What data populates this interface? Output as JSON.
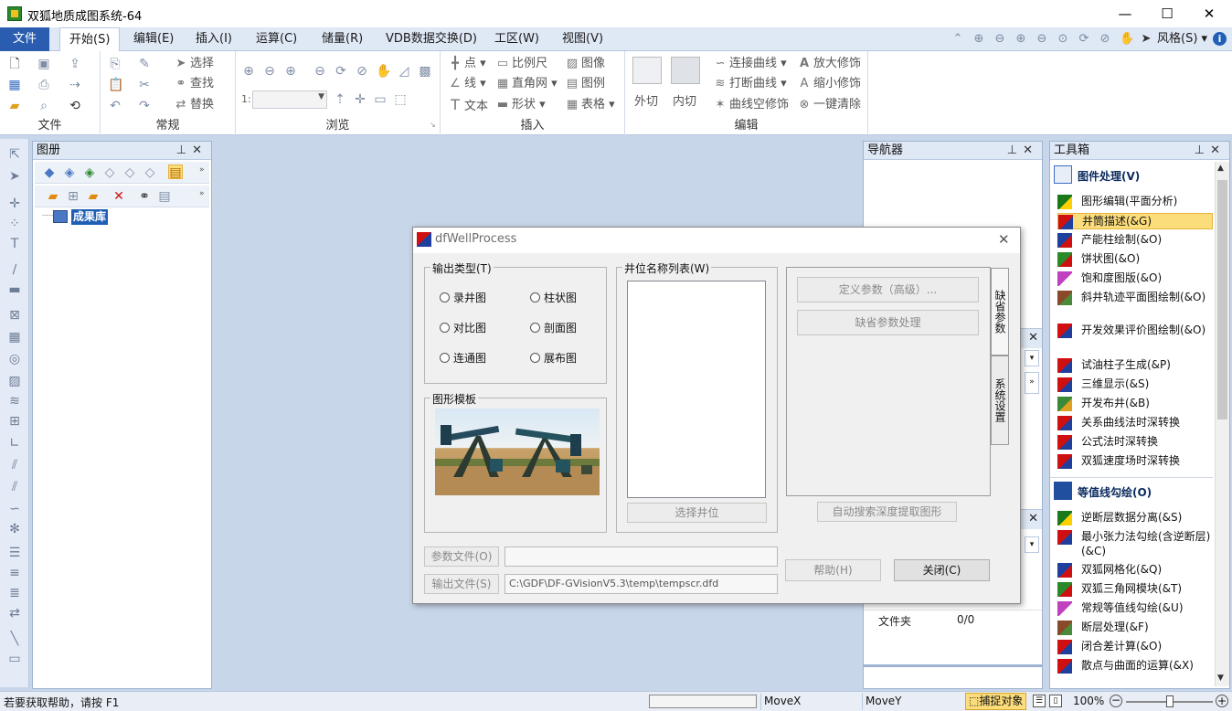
{
  "window": {
    "title": "双狐地质成图系统-64",
    "min": "—",
    "max": "☐",
    "close": "✕"
  },
  "menubar": {
    "file": "文件",
    "items": [
      "开始(S)",
      "编辑(E)",
      "插入(I)",
      "运算(C)",
      "储量(R)",
      "VDB数据交换(D)",
      "工区(W)",
      "视图(V)"
    ],
    "style": "风格(S)",
    "style_caret": "▾"
  },
  "ribbon": {
    "groups": {
      "file": "文件",
      "common": "常规",
      "browse": "浏览",
      "insert": "插入",
      "edit": "编辑"
    },
    "common": {
      "select": "选择",
      "find": "查找",
      "replace": "替换"
    },
    "browse": {
      "scale_prefix": "1:",
      "scale_value": ""
    },
    "insert": {
      "point": "点",
      "ruler": "比例尺",
      "image": "图像",
      "line": "线",
      "grid": "直角网",
      "legend": "图例",
      "text": "文本",
      "shape": "形状",
      "table": "表格"
    },
    "edit": {
      "outer_cut": "外切",
      "inner_cut": "内切",
      "connect_curve": "连接曲线",
      "break_curve": "打断曲线",
      "curve_decor": "曲线空修饰",
      "zoom_in_decor": "放大修饰",
      "zoom_out_decor": "缩小修饰",
      "clear_all": "一键清除"
    }
  },
  "layers_panel": {
    "title": "图册",
    "root": "成果库"
  },
  "navigator_panel": {
    "title": "导航器",
    "rows": [
      {
        "label": "文件夹",
        "value": "0/0"
      }
    ]
  },
  "toolbox": {
    "title": "工具箱",
    "sections": [
      {
        "header": "图件处理(V)",
        "items": [
          "图形编辑(平面分析)",
          "井筒描述(&G)",
          "产能柱绘制(&O)",
          "饼状图(&O)",
          "饱和度图版(&O)",
          "斜井轨迹平面图绘制(&O)",
          "开发效果评价图绘制(&O)",
          "试油柱子生成(&P)",
          "三维显示(&S)",
          "开发布井(&B)",
          "关系曲线法时深转换",
          "公式法时深转换",
          "双狐速度场时深转换"
        ],
        "selected_index": 1
      },
      {
        "header": "等值线勾绘(O)",
        "items": [
          "逆断层数据分离(&S)",
          "最小张力法勾绘(含逆断层)(&C)",
          "双狐网格化(&Q)",
          "双狐三角网模块(&T)",
          "常规等值线勾绘(&U)",
          "断层处理(&F)",
          "闭合差计算(&O)",
          "散点与曲面的运算(&X)"
        ]
      }
    ]
  },
  "dialog": {
    "title": "dfWellProcess",
    "close": "✕",
    "output_type": {
      "legend": "输出类型(T)",
      "options": [
        "录井图",
        "柱状图",
        "对比图",
        "剖面图",
        "连通图",
        "展布图"
      ]
    },
    "template": {
      "legend": "图形模板"
    },
    "well_list": {
      "legend": "井位名称列表(W)",
      "select_button": "选择井位"
    },
    "params": {
      "define_button": "定义参数（高级）...",
      "default_button": "缺省参数处理",
      "auto_search_button": "自动搜索深度提取图形",
      "tab_default": "缺省参数",
      "tab_system": "系统设置"
    },
    "param_file_button": "参数文件(O)",
    "param_file_value": "",
    "output_file_button": "输出文件(S)",
    "output_file_value": "C:\\GDF\\DF-GVisionV5.3\\temp\\tempscr.dfd",
    "help_button": "帮助(H)",
    "close_button": "关闭(C)"
  },
  "statusbar": {
    "help": "若要获取帮助，请按 F1",
    "movex": "MoveX",
    "movey": "MoveY",
    "snap": "捕捉对象",
    "zoom": "100%"
  },
  "colors": {
    "accent": "#2a5db0",
    "selected_item": "#fcdd7c",
    "workspace": "#c8d6ea"
  }
}
